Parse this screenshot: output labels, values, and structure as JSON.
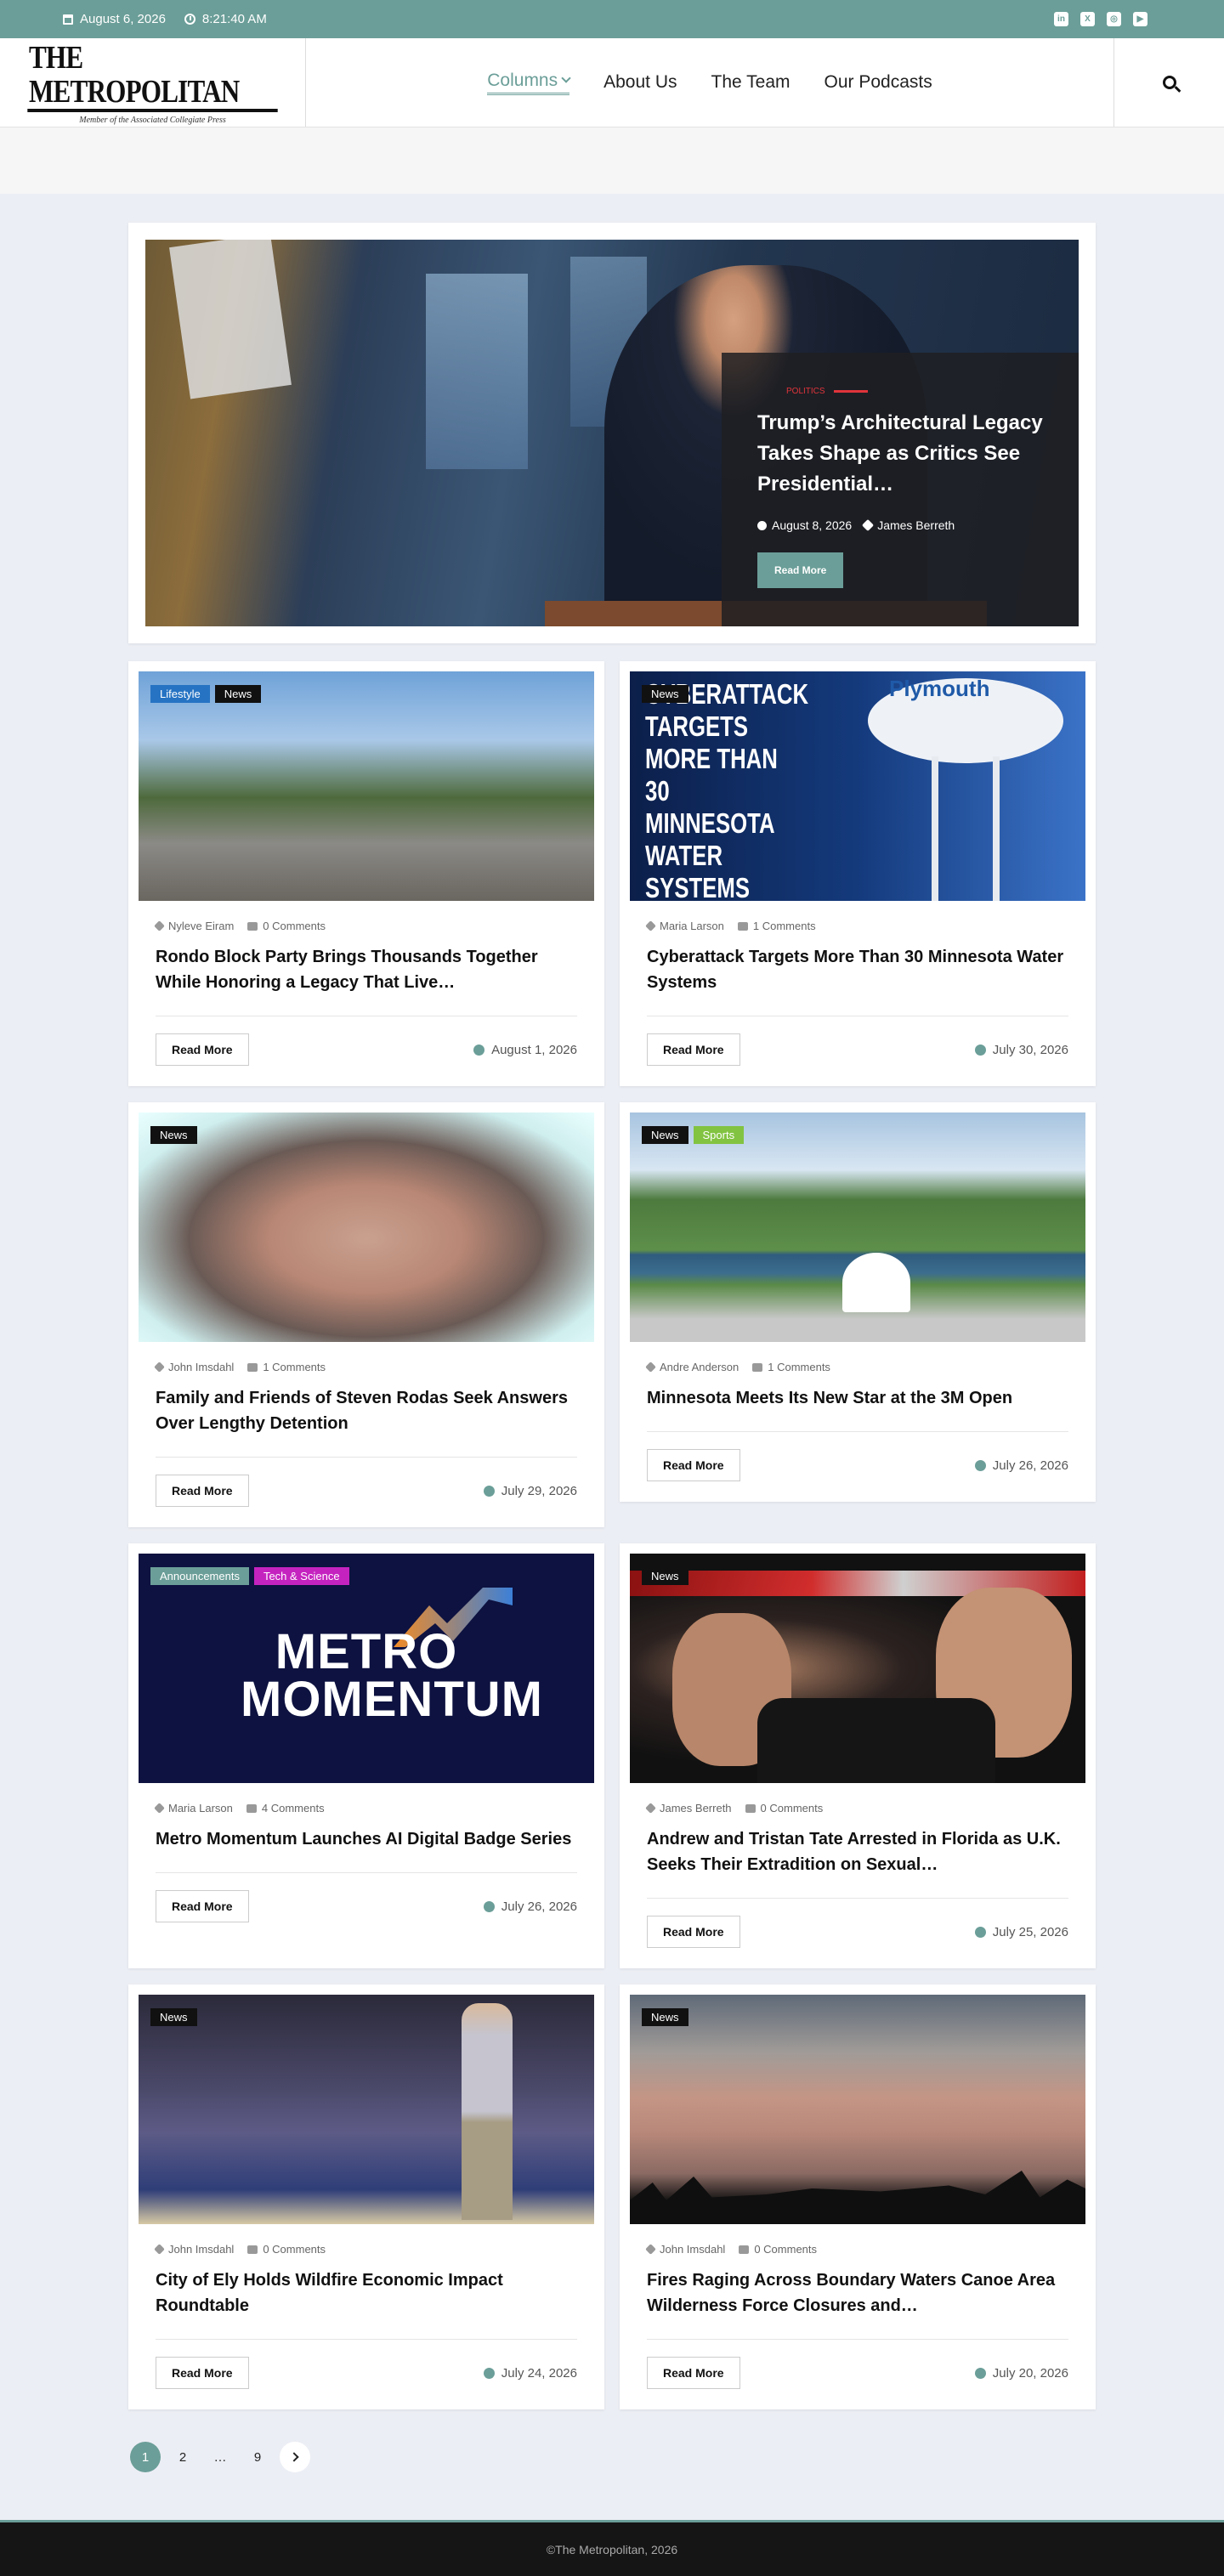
{
  "topbar": {
    "date": "August 6, 2026",
    "time": "8:21:40 AM",
    "socials": [
      "linkedin-icon",
      "x-icon",
      "instagram-icon",
      "youtube-icon"
    ]
  },
  "header": {
    "logo_title": "THE METROPOLITAN",
    "logo_sub": "Member of the Associated Collegiate Press",
    "nav": [
      "Columns",
      "About Us",
      "The Team",
      "Our Podcasts"
    ]
  },
  "hero": {
    "category": "POLITICS",
    "title": "Trump’s Architectural Legacy Takes Shape as Critics See Presidential…",
    "date": "August 8, 2026",
    "author": "James Berreth",
    "button": "Read More"
  },
  "cards": [
    {
      "tags": [
        "Lifestyle",
        "News"
      ],
      "author": "Nyleve Eiram",
      "comments": "0 Comments",
      "title": "Rondo Block Party Brings Thousands Together While Honoring a Legacy That Live…",
      "date": "August 1, 2026",
      "button": "Read More"
    },
    {
      "tags": [
        "News"
      ],
      "author": "Maria Larson",
      "comments": "1 Comments",
      "title": "Cyberattack Targets More Than 30 Minnesota Water Systems",
      "date": "July 30, 2026",
      "button": "Read More",
      "image_text": "CYBERATTACK TARGETS MORE THAN 30 MINNESOTA WATER SYSTEMS",
      "image_brand": "Plymouth"
    },
    {
      "tags": [
        "News"
      ],
      "author": "John Imsdahl",
      "comments": "1 Comments",
      "title": "Family and Friends of Steven Rodas Seek Answers Over Lengthy Detention",
      "date": "July 29, 2026",
      "button": "Read More"
    },
    {
      "tags": [
        "News",
        "Sports"
      ],
      "author": "Andre Anderson",
      "comments": "1 Comments",
      "title": "Minnesota Meets Its New Star at the 3M Open",
      "date": "July 26, 2026",
      "button": "Read More"
    },
    {
      "tags": [
        "Announcements",
        "Tech & Science"
      ],
      "author": "Maria Larson",
      "comments": "4 Comments",
      "title": "Metro Momentum Launches AI Digital Badge Series",
      "date": "July 26, 2026",
      "button": "Read More",
      "image_text": "METRO MOMENTUM"
    },
    {
      "tags": [
        "News"
      ],
      "author": "James Berreth",
      "comments": "0 Comments",
      "title": "Andrew and Tristan Tate Arrested in Florida as U.K. Seeks Their Extradition on Sexual…",
      "date": "July 25, 2026",
      "button": "Read More"
    },
    {
      "tags": [
        "News"
      ],
      "author": "John Imsdahl",
      "comments": "0 Comments",
      "title": "City of Ely Holds Wildfire Economic Impact Roundtable",
      "date": "July 24, 2026",
      "button": "Read More"
    },
    {
      "tags": [
        "News"
      ],
      "author": "John Imsdahl",
      "comments": "0 Comments",
      "title": "Fires Raging Across Boundary Waters Canoe Area Wilderness Force Closures and…",
      "date": "July 20, 2026",
      "button": "Read More"
    }
  ],
  "pagination": {
    "current": "1",
    "pages": [
      "2",
      "…",
      "9"
    ]
  },
  "footer": {
    "text": "©The Metropolitan, 2026"
  }
}
